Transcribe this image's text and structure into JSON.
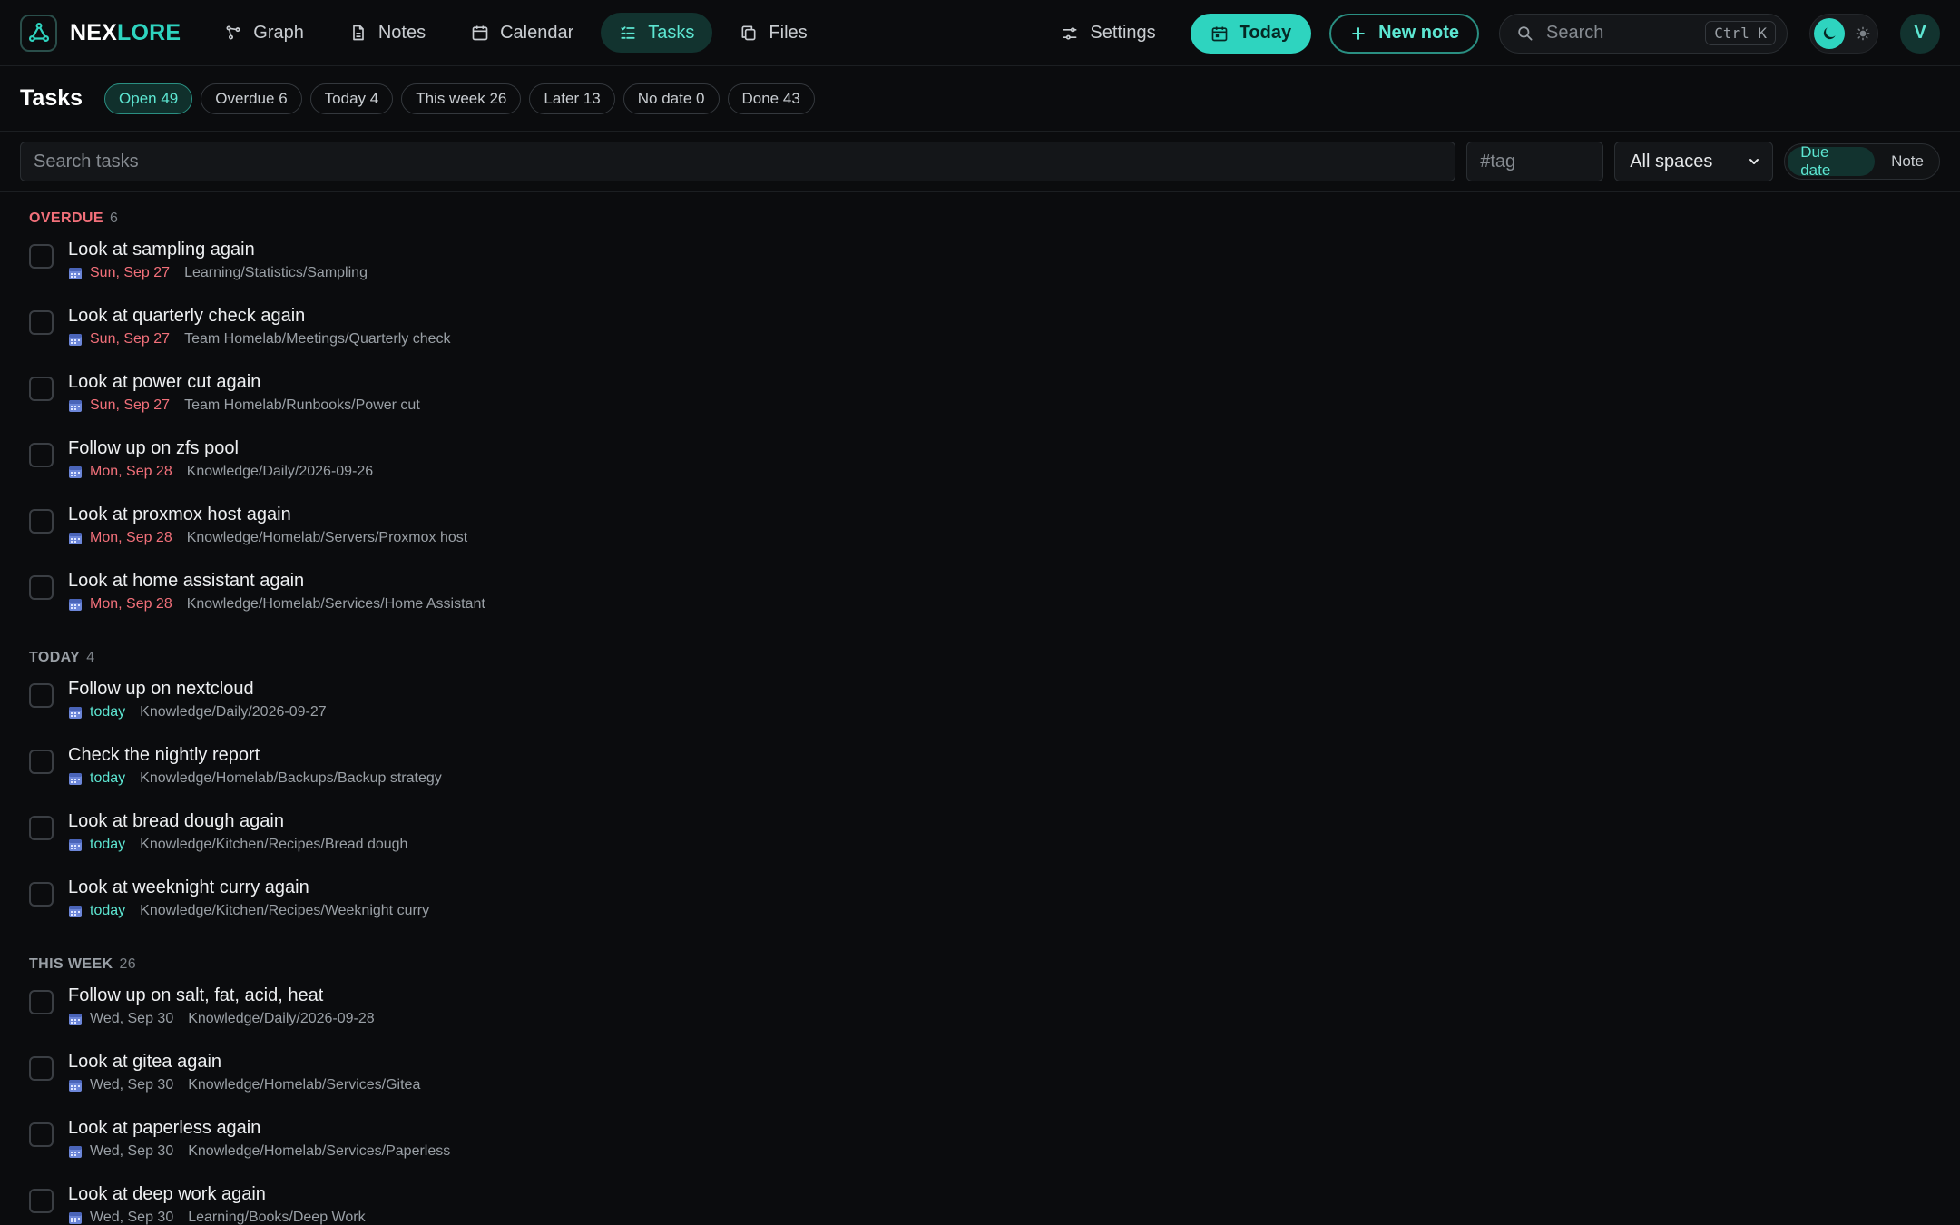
{
  "app": {
    "logo_a": "NEX",
    "logo_b": "LORE"
  },
  "nav": [
    {
      "id": "graph",
      "label": "Graph",
      "icon": "graph-icon",
      "active": false
    },
    {
      "id": "notes",
      "label": "Notes",
      "icon": "note-icon",
      "active": false
    },
    {
      "id": "calendar",
      "label": "Calendar",
      "icon": "calendar-icon",
      "active": false
    },
    {
      "id": "tasks",
      "label": "Tasks",
      "icon": "tasks-icon",
      "active": true
    },
    {
      "id": "files",
      "label": "Files",
      "icon": "files-icon",
      "active": false
    }
  ],
  "header": {
    "settings_label": "Settings",
    "today_label": "Today",
    "new_note_label": "New note",
    "search_placeholder": "Search",
    "search_shortcut": "Ctrl K",
    "avatar_initial": "V"
  },
  "page": {
    "title": "Tasks"
  },
  "chips": [
    {
      "label": "Open 49",
      "active": true
    },
    {
      "label": "Overdue 6",
      "active": false
    },
    {
      "label": "Today 4",
      "active": false
    },
    {
      "label": "This week 26",
      "active": false
    },
    {
      "label": "Later 13",
      "active": false
    },
    {
      "label": "No date 0",
      "active": false
    },
    {
      "label": "Done 43",
      "active": false
    }
  ],
  "filters": {
    "search_placeholder": "Search tasks",
    "tag_placeholder": "#tag",
    "space_selected": "All spaces",
    "sort_options": [
      "Due date",
      "Note"
    ],
    "sort_active": "Due date"
  },
  "groups": [
    {
      "kind": "overdue",
      "label": "OVERDUE",
      "count": "6",
      "tasks": [
        {
          "title": "Look at sampling again",
          "date": "Sun, Sep 27",
          "path": "Learning/Statistics/Sampling"
        },
        {
          "title": "Look at quarterly check again",
          "date": "Sun, Sep 27",
          "path": "Team Homelab/Meetings/Quarterly check"
        },
        {
          "title": "Look at power cut again",
          "date": "Sun, Sep 27",
          "path": "Team Homelab/Runbooks/Power cut"
        },
        {
          "title": "Follow up on zfs pool",
          "date": "Mon, Sep 28",
          "path": "Knowledge/Daily/2026-09-26"
        },
        {
          "title": "Look at proxmox host again",
          "date": "Mon, Sep 28",
          "path": "Knowledge/Homelab/Servers/Proxmox host"
        },
        {
          "title": "Look at home assistant again",
          "date": "Mon, Sep 28",
          "path": "Knowledge/Homelab/Services/Home Assistant"
        }
      ]
    },
    {
      "kind": "today",
      "label": "TODAY",
      "count": "4",
      "tasks": [
        {
          "title": "Follow up on nextcloud",
          "date": "today",
          "path": "Knowledge/Daily/2026-09-27"
        },
        {
          "title": "Check the nightly report",
          "date": "today",
          "path": "Knowledge/Homelab/Backups/Backup strategy"
        },
        {
          "title": "Look at bread dough again",
          "date": "today",
          "path": "Knowledge/Kitchen/Recipes/Bread dough"
        },
        {
          "title": "Look at weeknight curry again",
          "date": "today",
          "path": "Knowledge/Kitchen/Recipes/Weeknight curry"
        }
      ]
    },
    {
      "kind": "week",
      "label": "THIS WEEK",
      "count": "26",
      "tasks": [
        {
          "title": "Follow up on salt, fat, acid, heat",
          "date": "Wed, Sep 30",
          "path": "Knowledge/Daily/2026-09-28"
        },
        {
          "title": "Look at gitea again",
          "date": "Wed, Sep 30",
          "path": "Knowledge/Homelab/Services/Gitea"
        },
        {
          "title": "Look at paperless again",
          "date": "Wed, Sep 30",
          "path": "Knowledge/Homelab/Services/Paperless"
        },
        {
          "title": "Look at deep work again",
          "date": "Wed, Sep 30",
          "path": "Learning/Books/Deep Work"
        }
      ]
    }
  ],
  "colors": {
    "accent": "#2ed4bf",
    "overdue": "#f2707a",
    "background": "#0b0c0e"
  }
}
